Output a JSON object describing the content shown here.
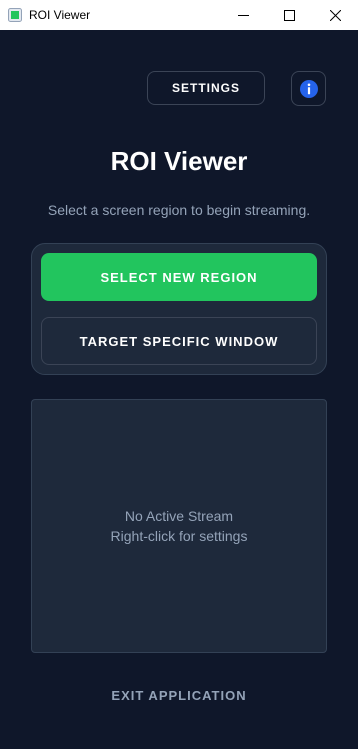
{
  "window": {
    "title": "ROI Viewer",
    "icon": "app-icon",
    "controls": [
      "minimize-icon",
      "maximize-icon",
      "close-icon"
    ]
  },
  "header": {
    "settings_label": "SETTINGS",
    "info_icon": "info-icon"
  },
  "main": {
    "heading": "ROI Viewer",
    "subtitle": "Select a screen region to begin streaming.",
    "primary_button": "SELECT NEW REGION",
    "secondary_button": "TARGET SPECIFIC WINDOW"
  },
  "preview": {
    "status": "No Active Stream",
    "hint": "Right-click for settings"
  },
  "footer": {
    "exit_label": "EXIT APPLICATION"
  },
  "colors": {
    "background": "#0f172a",
    "panel": "#1e293b",
    "accent_green": "#22c55e",
    "info_blue": "#2563eb",
    "muted_text": "#94a3b8"
  }
}
